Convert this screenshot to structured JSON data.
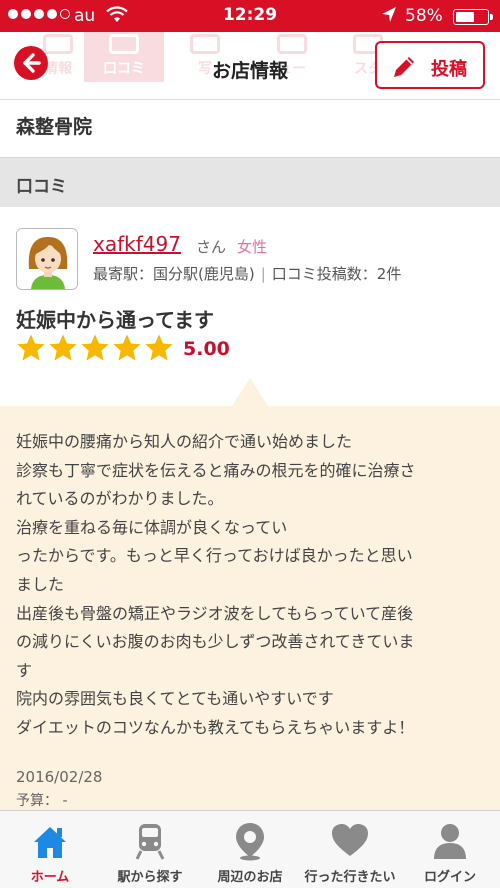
{
  "status_bar": {
    "carrier": "au",
    "time": "12:29",
    "battery": "58%",
    "battery_level": 0.58
  },
  "header": {
    "title": "お店情報",
    "post_label": "投稿",
    "ghost_tabs": [
      "情報",
      "口コミ",
      "写",
      "ュー",
      "スタ"
    ]
  },
  "shop": {
    "name": "森整骨院"
  },
  "section": {
    "label": "口コミ"
  },
  "review": {
    "reviewer": "xafkf497",
    "honorific": "さん",
    "gender": "女性",
    "station": "最寄駅：国分駅(鹿児島)",
    "post_count": "口コミ投稿数：2件",
    "title": "妊娠中から通ってます",
    "rating": "5.00",
    "stars": 5,
    "body_lines": [
      "妊娠中の腰痛から知人の紹介で通い始めました",
      "診察も丁寧で症状を伝えると痛みの根元を的確に治療さ",
      "れているのがわかりました。",
      "治療を重ねる毎に体調が良くなってい",
      "ったからです。もっと早く行っておけば良かったと思い",
      "ました",
      "出産後も骨盤の矯正やラジオ波をしてもらっていて産後",
      "の減りにくいお腹のお肉も少しずつ改善されてきていま",
      "す",
      "院内の雰囲気も良くてとても通いやすいです",
      "ダイエットのコツなんかも教えてもらえちゃいますよ！"
    ],
    "date": "2016/02/28",
    "budget": "予算： -"
  },
  "tabbar": {
    "items": [
      {
        "label": "ホーム",
        "icon": "home-icon",
        "active": true
      },
      {
        "label": "駅から探す",
        "icon": "train-icon",
        "active": false
      },
      {
        "label": "周辺のお店",
        "icon": "location-pin-icon",
        "active": false
      },
      {
        "label": "行った行きたい",
        "icon": "heart-icon",
        "active": false
      },
      {
        "label": "ログイン",
        "icon": "user-icon",
        "active": false
      }
    ]
  },
  "colors": {
    "brand": "#d90f25",
    "review_bg": "#fdf1df",
    "star": "#f6b800",
    "home_icon": "#1e88e5"
  }
}
